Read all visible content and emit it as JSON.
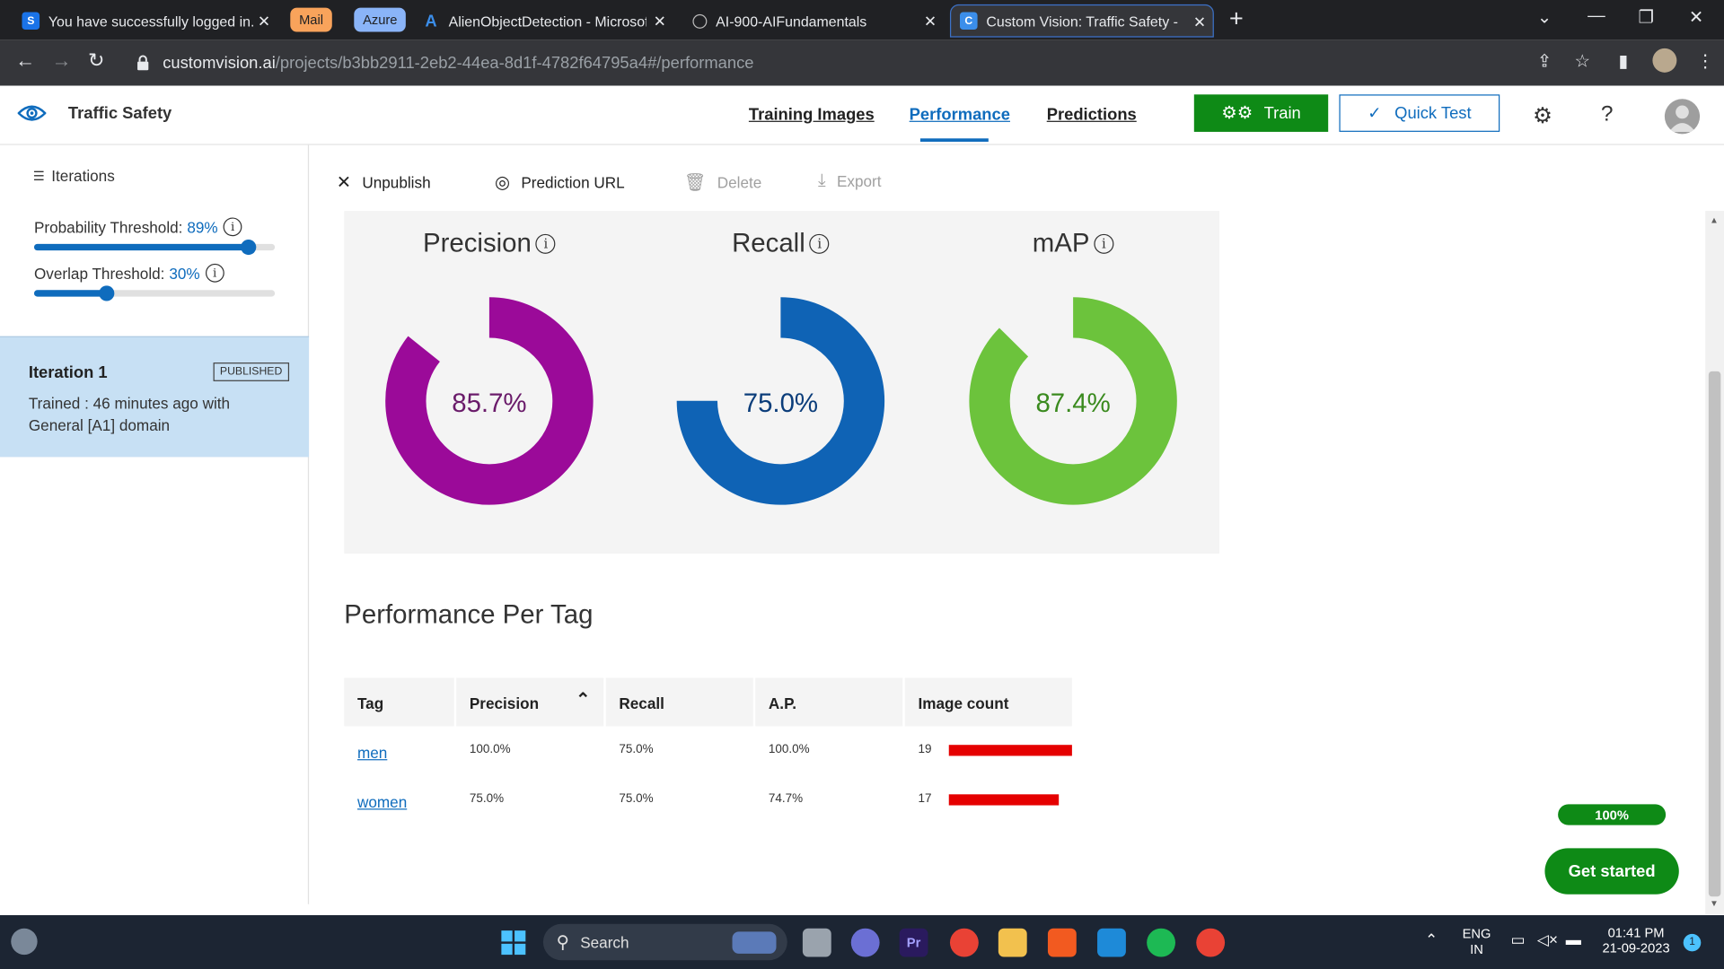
{
  "browser": {
    "tabs": [
      {
        "title": "You have successfully logged in.",
        "icon": "s-icon"
      },
      {
        "title": "AlienObjectDetection - Microsoft",
        "icon": "azure-icon"
      },
      {
        "title": "AI-900-AIFundamentals",
        "icon": "globe-icon"
      },
      {
        "title": "Custom Vision: Traffic Safety - Pe",
        "icon": "customvision-icon"
      }
    ],
    "groups": [
      {
        "label": "Mail",
        "color": "#f9a35b"
      },
      {
        "label": "Azure",
        "color": "#8ab4f8"
      }
    ],
    "url_host": "customvision.ai",
    "url_path": "/projects/b3bb2911-2eb2-44ea-8d1f-4782f64795a4#/performance"
  },
  "header": {
    "project_name": "Traffic Safety",
    "nav": [
      "Training Images",
      "Performance",
      "Predictions"
    ],
    "active_nav": "Performance",
    "train_label": "Train",
    "quick_test_label": "Quick Test"
  },
  "sidebar": {
    "iterations_label": "Iterations",
    "probability_label": "Probability Threshold:",
    "probability_value": "89%",
    "probability_fraction": 0.89,
    "overlap_label": "Overlap Threshold:",
    "overlap_value": "30%",
    "overlap_fraction": 0.3,
    "iteration": {
      "name": "Iteration 1",
      "badge": "PUBLISHED",
      "desc": "Trained : 46 minutes ago with General [A1] domain"
    }
  },
  "toolbar": {
    "unpublish": "Unpublish",
    "prediction_url": "Prediction URL",
    "delete": "Delete",
    "export": "Export"
  },
  "metrics": [
    {
      "title": "Precision",
      "value": "85.7%",
      "fraction": 0.857,
      "color": "#9b0a99",
      "text_color": "#6a1b6a"
    },
    {
      "title": "Recall",
      "value": "75.0%",
      "fraction": 0.75,
      "color": "#0f63b5",
      "text_color": "#0b3d7a"
    },
    {
      "title": "mAP",
      "value": "87.4%",
      "fraction": 0.874,
      "color": "#6cc33c",
      "text_color": "#3a8a1e"
    }
  ],
  "per_tag": {
    "title": "Performance Per Tag",
    "columns": [
      "Tag",
      "Precision",
      "Recall",
      "A.P.",
      "Image count"
    ],
    "rows": [
      {
        "tag": "men",
        "precision": "100.0%",
        "recall": "75.0%",
        "ap": "100.0%",
        "count": "19",
        "count_value": 19
      },
      {
        "tag": "women",
        "precision": "75.0%",
        "recall": "75.0%",
        "ap": "74.7%",
        "count": "17",
        "count_value": 17
      }
    ]
  },
  "progress_label": "100%",
  "get_started": "Get started",
  "taskbar": {
    "search_label": "Search",
    "lang": "ENG",
    "region": "IN",
    "time": "01:41 PM",
    "date": "21-09-2023",
    "notification_count": "1"
  }
}
